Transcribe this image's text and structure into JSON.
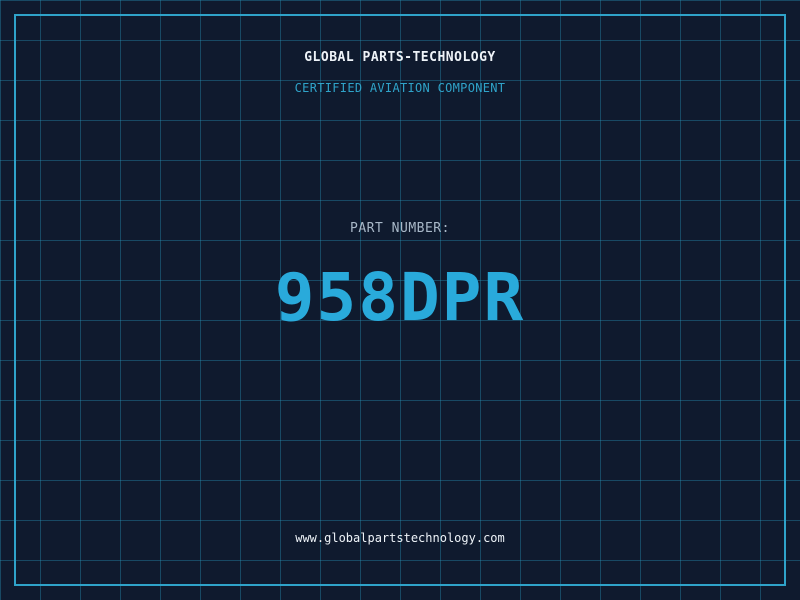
{
  "header": {
    "company": "GLOBAL PARTS-TECHNOLOGY",
    "subtitle": "CERTIFIED AVIATION COMPONENT"
  },
  "part": {
    "label": "PART NUMBER:",
    "number": "958DPR"
  },
  "footer": {
    "website": "www.globalpartstechnology.com"
  },
  "colors": {
    "background": "#0f1a2e",
    "grid": "#2896b9",
    "accent": "#29aadb",
    "text": "#eef3f8"
  }
}
